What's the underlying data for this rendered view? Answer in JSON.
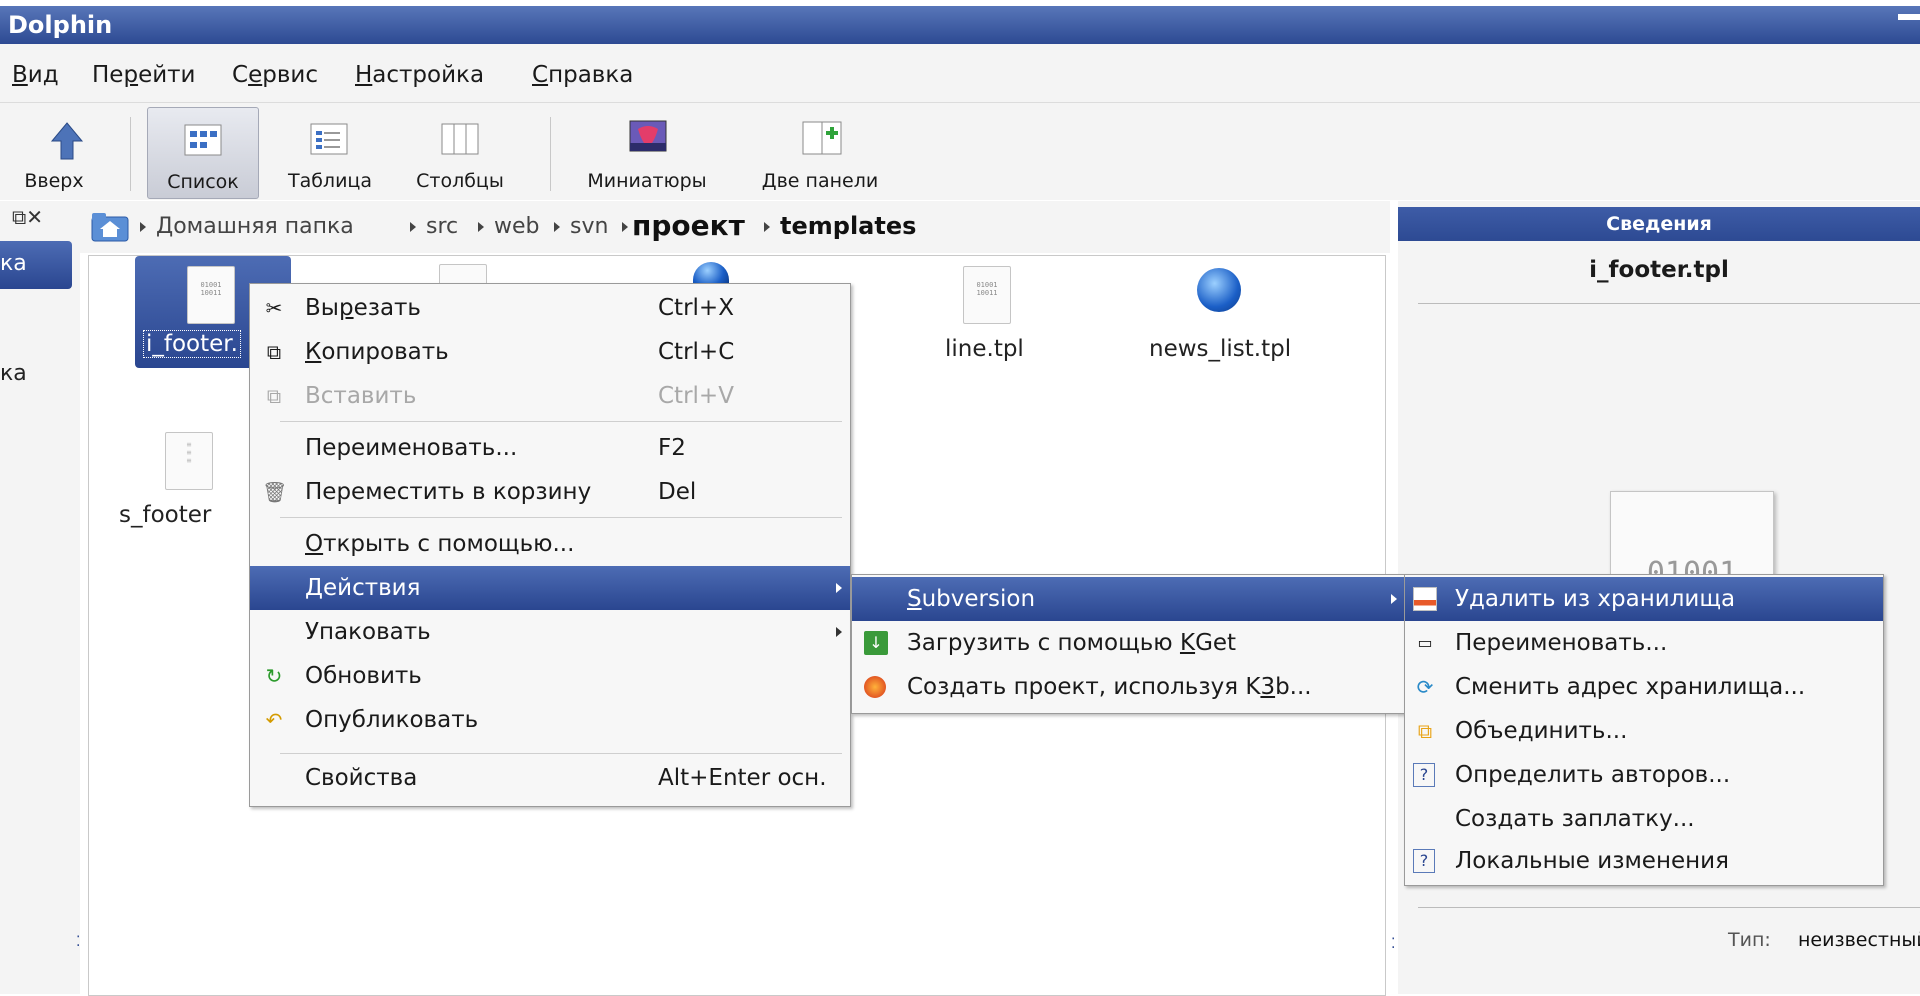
{
  "window": {
    "title": "Dolphin"
  },
  "menubar": [
    "Вид",
    "Перейти",
    "Сервис",
    "Настройка",
    "Справка"
  ],
  "toolbar": {
    "up": "Вверх",
    "list": "Список",
    "table": "Таблица",
    "columns": "Столбцы",
    "thumbs": "Миниатюры",
    "split": "Две панели"
  },
  "breadcrumb": {
    "home": "Домашняя папка",
    "src": "src",
    "web": "web",
    "svn": "svn",
    "project": "проект",
    "current": "templates"
  },
  "sidebar": {
    "item1": "ка",
    "item2": "ка"
  },
  "files": {
    "f1": "i_footer.",
    "f2": "line.tpl",
    "f3": "news_list.tpl",
    "f4": "s_footer"
  },
  "info": {
    "header": "Сведения",
    "filename": "i_footer.tpl",
    "type_label": "Тип:",
    "type_value": "неизвестный"
  },
  "context_menu": {
    "cut": "Вырезать",
    "cut_sc": "Ctrl+X",
    "copy": "Копировать",
    "copy_sc": "Ctrl+C",
    "paste": "Вставить",
    "paste_sc": "Ctrl+V",
    "rename": "Переименовать...",
    "rename_sc": "F2",
    "trash": "Переместить в корзину",
    "trash_sc": "Del",
    "open_with": "Открыть с помощью...",
    "actions": "Действия",
    "pack": "Упаковать",
    "refresh": "Обновить",
    "publish": "Опубликовать",
    "properties": "Свойства",
    "properties_sc": "Alt+Enter осн."
  },
  "actions_menu": {
    "subversion": "Subversion",
    "kget": "Загрузить с помощью KGet",
    "k3b": "Создать проект, используя K3b..."
  },
  "svn_menu": {
    "delete": "Удалить из хранилища",
    "rename": "Переименовать...",
    "relocate": "Сменить адрес хранилища...",
    "merge": "Объединить...",
    "blame": "Определить авторов...",
    "patch": "Создать заплатку...",
    "diff": "Локальные изменения"
  },
  "colors": {
    "highlight": "#2d4a93",
    "titlebar": "#2d4a93"
  }
}
